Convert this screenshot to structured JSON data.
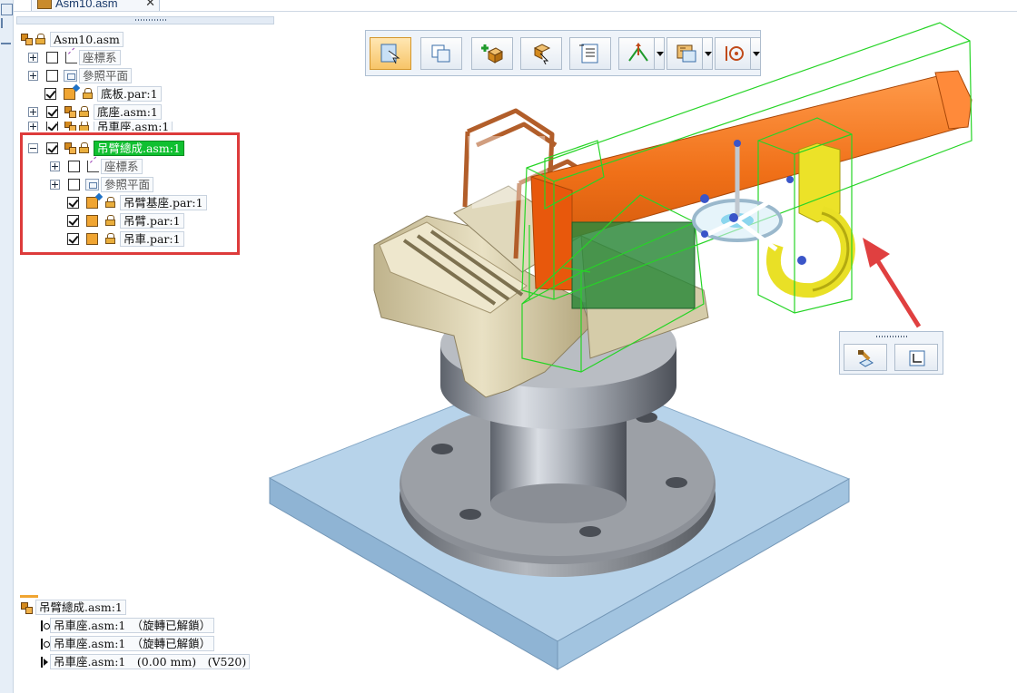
{
  "document_tab": {
    "title": "Asm10.asm",
    "close_glyph": "✕"
  },
  "tree": {
    "items": [
      {
        "label": "Asm10.asm",
        "icon": "assembly-icon",
        "checked": null
      },
      {
        "label": "座標系",
        "icon": "coordinate-system-icon",
        "checked": false
      },
      {
        "label": "參照平面",
        "icon": "reference-plane-icon",
        "checked": false
      },
      {
        "label": "底板.par:1",
        "icon": "part-icon",
        "checked": true
      },
      {
        "label": "底座.asm:1",
        "icon": "assembly-icon",
        "checked": true
      },
      {
        "label": "吊車座.asm:1",
        "icon": "assembly-icon",
        "checked": true
      },
      {
        "label": "吊臂總成.asm:1",
        "icon": "assembly-icon",
        "checked": true,
        "selected": true
      },
      {
        "label": "座標系",
        "icon": "coordinate-system-icon",
        "checked": false
      },
      {
        "label": "參照平面",
        "icon": "reference-plane-icon",
        "checked": false
      },
      {
        "label": "吊臂基座.par:1",
        "icon": "part-icon",
        "checked": true
      },
      {
        "label": "吊臂.par:1",
        "icon": "part-icon",
        "checked": true
      },
      {
        "label": "吊車.par:1",
        "icon": "part-icon",
        "checked": true
      }
    ]
  },
  "relationships": {
    "title": "吊臂總成.asm:1",
    "items": [
      {
        "label": "吊車座.asm:1　（旋轉已解鎖）",
        "icon": "axial-align-icon"
      },
      {
        "label": "吊車座.asm:1　（旋轉已解鎖）",
        "icon": "axial-align-icon"
      },
      {
        "label": "吊車座.asm:1　(0.00 mm)　(V520)",
        "icon": "planar-offset-icon"
      }
    ]
  },
  "toolbar": {
    "buttons": [
      {
        "name": "select-part-button",
        "icon": "select-icon",
        "active": true
      },
      {
        "name": "copy-button",
        "icon": "copy-icon"
      },
      {
        "name": "add-part-button",
        "icon": "add-part-icon"
      },
      {
        "name": "move-part-button",
        "icon": "move-icon"
      },
      {
        "name": "properties-button",
        "icon": "list-icon"
      },
      {
        "name": "relate-button",
        "icon": "relate-icon",
        "dropdown": true
      },
      {
        "name": "assembly-button",
        "icon": "assembly-icon",
        "dropdown": true
      },
      {
        "name": "steering-button",
        "icon": "steering-wheel-icon",
        "dropdown": true
      }
    ]
  },
  "mini_toolbar": {
    "buttons": [
      {
        "name": "edit-definition-button",
        "icon": "edit-icon"
      },
      {
        "name": "fit-button",
        "icon": "fit-icon"
      }
    ]
  },
  "colors": {
    "selection_green": "#10c030",
    "highlight_red": "#dd3b3b",
    "boom_orange": "#f0751e",
    "hook_yellow": "#e9e026",
    "wireframe_green": "#26d426",
    "base_plate_blue": "#a9cbe6",
    "arrow_red": "#e04040"
  }
}
